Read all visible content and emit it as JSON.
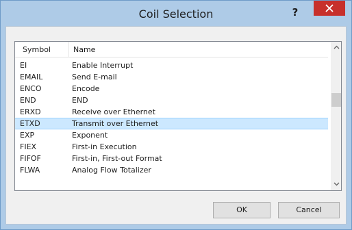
{
  "window": {
    "title": "Coil Selection",
    "help_label": "?"
  },
  "list": {
    "columns": [
      "Symbol",
      "Name"
    ],
    "rows": [
      {
        "symbol": "EI",
        "name": "Enable Interrupt",
        "selected": false
      },
      {
        "symbol": "EMAIL",
        "name": "Send E-mail",
        "selected": false
      },
      {
        "symbol": "ENCO",
        "name": "Encode",
        "selected": false
      },
      {
        "symbol": "END",
        "name": "END",
        "selected": false
      },
      {
        "symbol": "ERXD",
        "name": "Receive over Ethernet",
        "selected": false
      },
      {
        "symbol": "ETXD",
        "name": "Transmit over Ethernet",
        "selected": true
      },
      {
        "symbol": "EXP",
        "name": "Exponent",
        "selected": false
      },
      {
        "symbol": "FIEX",
        "name": "First-in Execution",
        "selected": false
      },
      {
        "symbol": "FIFOF",
        "name": "First-in, First-out Format",
        "selected": false
      },
      {
        "symbol": "FLWA",
        "name": "Analog Flow Totalizer",
        "selected": false
      }
    ]
  },
  "buttons": {
    "ok_label": "OK",
    "cancel_label": "Cancel"
  },
  "icons": {
    "close": "close-icon",
    "scroll_up": "scroll-up-icon",
    "scroll_down": "scroll-down-icon"
  },
  "colors": {
    "title_bar": "#aecbe7",
    "close_button": "#c7302b",
    "selection": "#cce8ff"
  }
}
